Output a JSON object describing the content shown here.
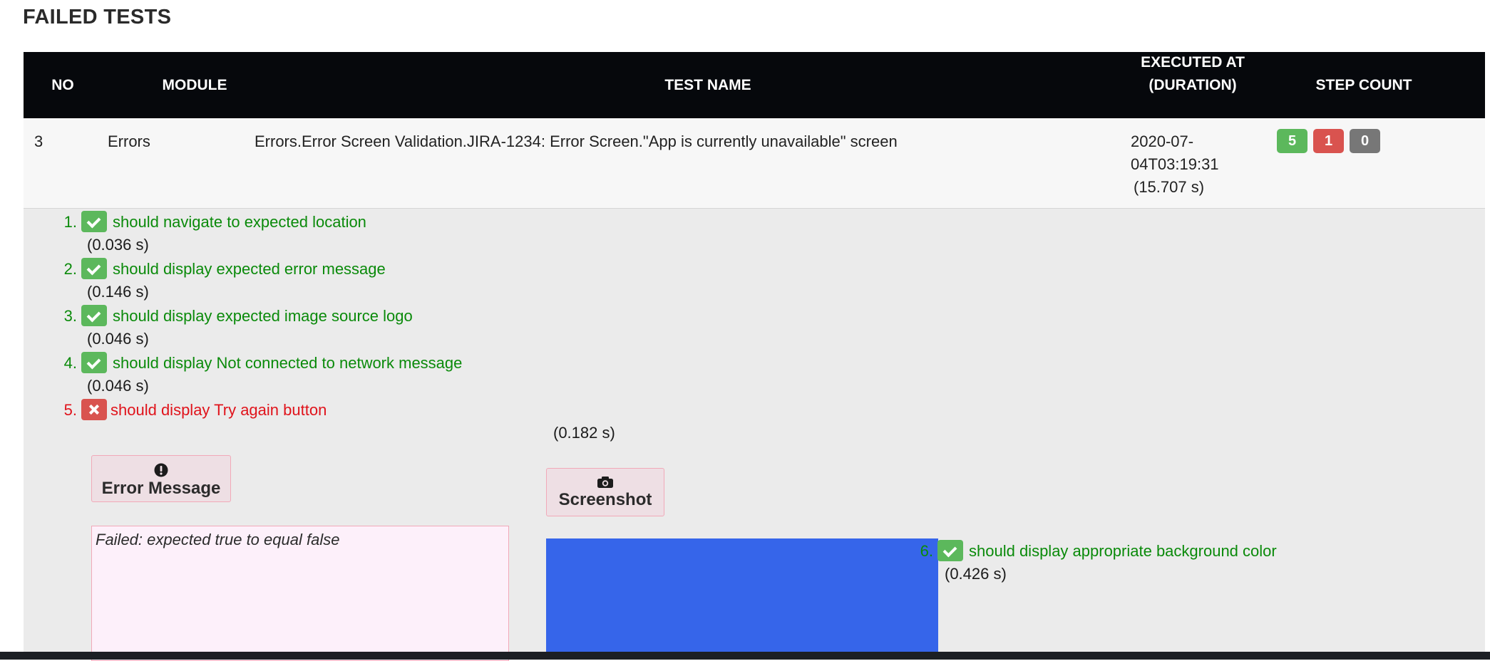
{
  "page_title": "FAILED TESTS",
  "columns": {
    "no": "NO",
    "module": "MODULE",
    "test_name": "TEST NAME",
    "executed_line1": "EXECUTED AT",
    "executed_line2": "(DURATION)",
    "step_count": "STEP COUNT"
  },
  "row": {
    "no": "3",
    "module": "Errors",
    "test_name": "Errors.Error Screen Validation.JIRA-1234: Error Screen.\"App is currently unavailable\" screen",
    "executed_line1": "2020-07-",
    "executed_line2": "04T03:19:31",
    "executed_line3": "(15.707 s)",
    "counts": {
      "passed": "5",
      "failed": "1",
      "skipped": "0"
    }
  },
  "steps": [
    {
      "num": "1.",
      "status": "passed",
      "label": "should navigate to expected location",
      "duration": "(0.036 s)"
    },
    {
      "num": "2.",
      "status": "passed",
      "label": "should display expected error message",
      "duration": "(0.146 s)"
    },
    {
      "num": "3.",
      "status": "passed",
      "label": "should display expected image source logo",
      "duration": "(0.046 s)"
    },
    {
      "num": "4.",
      "status": "passed",
      "label": "should display Not connected to network message",
      "duration": "(0.046 s)"
    },
    {
      "num": "5.",
      "status": "failed",
      "label": "should display Try again button",
      "duration": "(0.182 s)"
    },
    {
      "num": "6.",
      "status": "passed",
      "label": "should display appropriate background color",
      "duration": "(0.426 s)"
    }
  ],
  "error_button_label": "Error Message",
  "screenshot_button_label": "Screenshot",
  "error_text": "Failed: expected true to equal false",
  "colors": {
    "header_bg": "#06080c",
    "pass": "#5cb85c",
    "fail": "#d9534f",
    "skip": "#777777",
    "pass_text": "#0a8a0a",
    "fail_text": "#e0131b",
    "screenshot_fill": "#3665ea"
  },
  "icons": {
    "pass": "check-icon",
    "fail": "x-icon",
    "error": "exclamation-circle-icon",
    "screenshot": "camera-icon"
  }
}
